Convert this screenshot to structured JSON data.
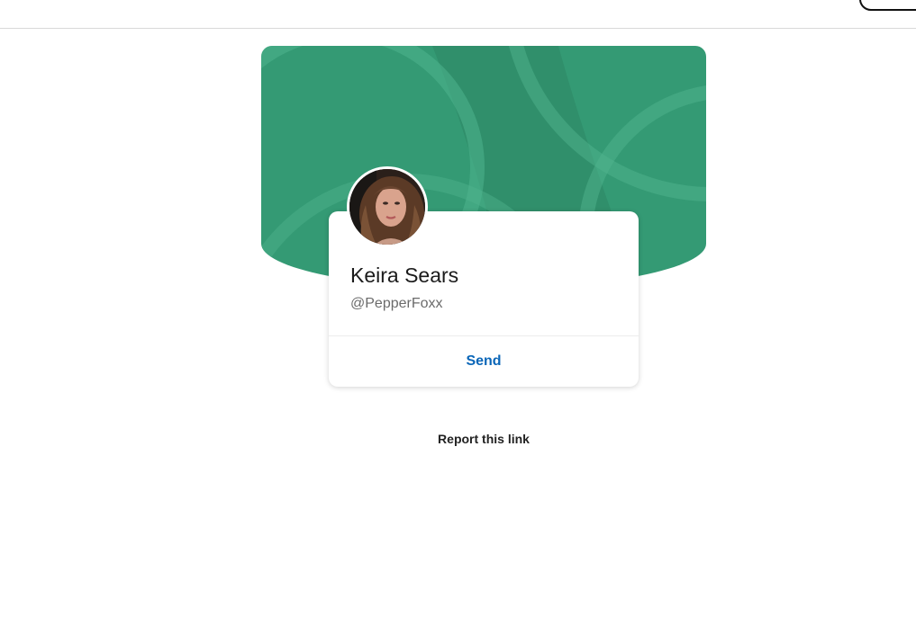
{
  "profile": {
    "name": "Keira Sears",
    "handle": "@PepperFoxx"
  },
  "actions": {
    "send_label": "Send",
    "report_label": "Report this link"
  },
  "colors": {
    "banner": "#349a74",
    "link": "#0a66b8"
  },
  "icons": {
    "avatar": "profile-photo"
  }
}
